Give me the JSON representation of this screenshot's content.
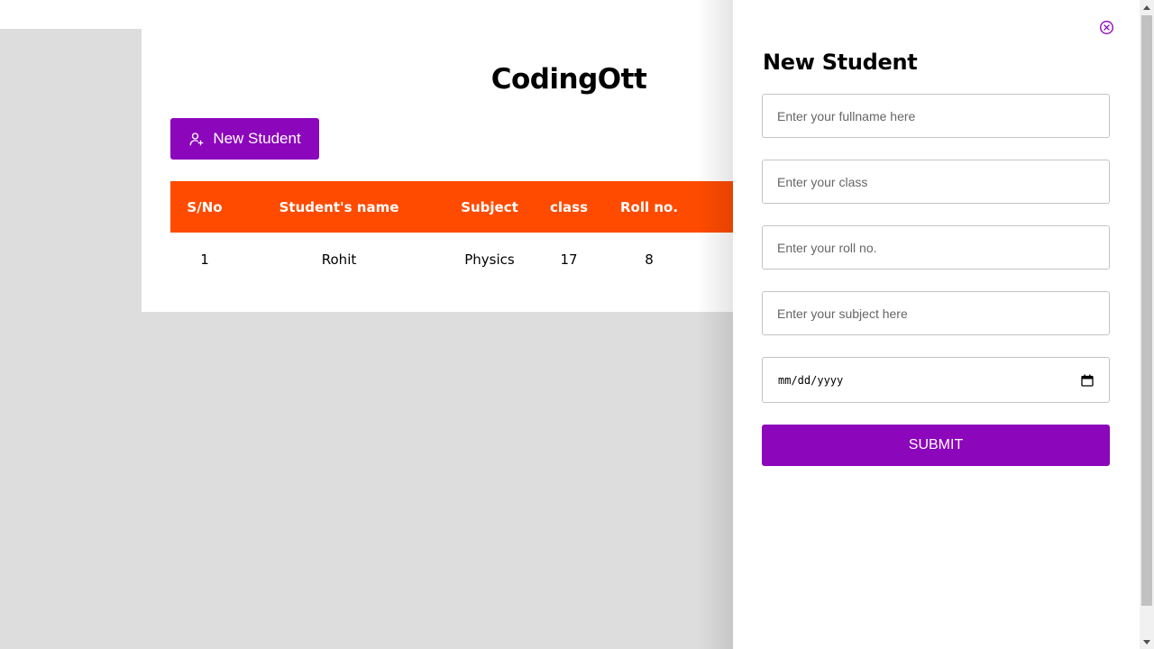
{
  "app": {
    "title": "CodingOtt"
  },
  "toolbar": {
    "new_student_label": "New Student",
    "new_student_icon": "user-plus-icon"
  },
  "table": {
    "columns": [
      "S/No",
      "Student's name",
      "Subject",
      "class",
      "Roll no."
    ],
    "rows": [
      {
        "sno": "1",
        "name": "Rohit",
        "subject": "Physics",
        "class": "17",
        "roll": "8"
      }
    ]
  },
  "drawer": {
    "title": "New Student",
    "close_icon": "close-circle-icon",
    "fields": {
      "fullname": {
        "placeholder": "Enter your fullname here",
        "value": ""
      },
      "class": {
        "placeholder": "Enter your class",
        "value": ""
      },
      "roll": {
        "placeholder": "Enter your roll no.",
        "value": ""
      },
      "subject": {
        "placeholder": "Enter your subject here",
        "value": ""
      },
      "date": {
        "display": "mm/dd/yyyy",
        "icon": "calendar-icon"
      }
    },
    "submit_label": "SUBMIT"
  },
  "colors": {
    "accent": "#8c06bb",
    "table_header": "#ff4b00",
    "backdrop": "#dddddd"
  }
}
